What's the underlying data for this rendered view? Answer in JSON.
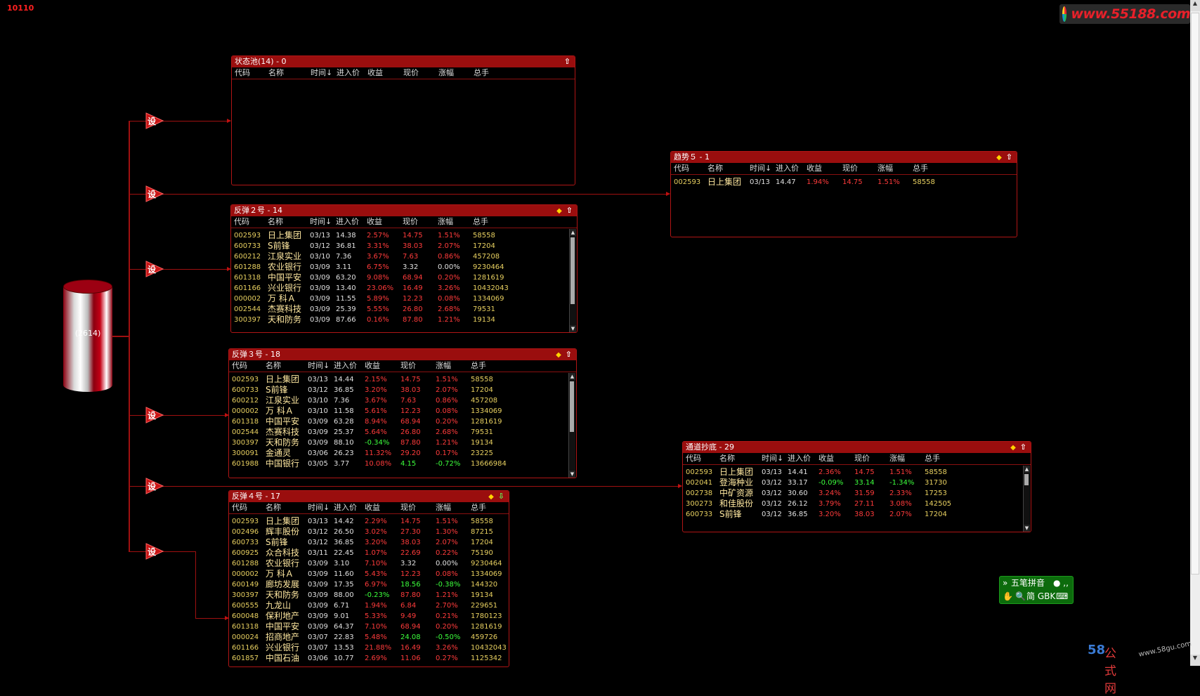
{
  "top_id": "10110",
  "logo_url": "www.55188.com",
  "database": {
    "label": "(2614)"
  },
  "set_label": "设",
  "columns": [
    "代码",
    "名称",
    "时间↓",
    "进入价",
    "收益",
    "现价",
    "涨幅",
    "总手"
  ],
  "colors": {
    "title_bar": "#9a0e0e",
    "border": "#b01515",
    "up": "#ff3b3b",
    "down": "#3cff3c",
    "code": "#e8d060"
  },
  "panels": {
    "p1": {
      "title": "状态池(14) - 0",
      "rows": []
    },
    "p2": {
      "title": "反弹２号 - 14",
      "rows": [
        [
          "002593",
          "日上集团",
          "03/13",
          "14.38",
          "2.57%",
          "14.75",
          "1.51%",
          "58558"
        ],
        [
          "600733",
          "S前锋",
          "03/12",
          "36.81",
          "3.31%",
          "38.03",
          "2.07%",
          "17204"
        ],
        [
          "600212",
          "江泉实业",
          "03/10",
          "7.36",
          "3.67%",
          "7.63",
          "0.86%",
          "457208"
        ],
        [
          "601288",
          "农业银行",
          "03/09",
          "3.11",
          "6.75%",
          "3.32",
          "0.00%",
          "9230464"
        ],
        [
          "601318",
          "中国平安",
          "03/09",
          "63.20",
          "9.08%",
          "68.94",
          "0.20%",
          "1281619"
        ],
        [
          "601166",
          "兴业银行",
          "03/09",
          "13.40",
          "23.06%",
          "16.49",
          "3.26%",
          "10432043"
        ],
        [
          "000002",
          "万 科Ａ",
          "03/09",
          "11.55",
          "5.89%",
          "12.23",
          "0.08%",
          "1334069"
        ],
        [
          "002544",
          "杰赛科技",
          "03/09",
          "25.39",
          "5.55%",
          "26.80",
          "2.68%",
          "79531"
        ],
        [
          "300397",
          "天和防务",
          "03/09",
          "87.66",
          "0.16%",
          "87.80",
          "1.21%",
          "19134"
        ]
      ]
    },
    "p3": {
      "title": "反弹３号 - 18",
      "rows": [
        [
          "002593",
          "日上集团",
          "03/13",
          "14.44",
          "2.15%",
          "14.75",
          "1.51%",
          "58558"
        ],
        [
          "600733",
          "S前锋",
          "03/12",
          "36.85",
          "3.20%",
          "38.03",
          "2.07%",
          "17204"
        ],
        [
          "600212",
          "江泉实业",
          "03/10",
          "7.36",
          "3.67%",
          "7.63",
          "0.86%",
          "457208"
        ],
        [
          "000002",
          "万 科Ａ",
          "03/10",
          "11.58",
          "5.61%",
          "12.23",
          "0.08%",
          "1334069"
        ],
        [
          "601318",
          "中国平安",
          "03/09",
          "63.28",
          "8.94%",
          "68.94",
          "0.20%",
          "1281619"
        ],
        [
          "002544",
          "杰赛科技",
          "03/09",
          "25.37",
          "5.64%",
          "26.80",
          "2.68%",
          "79531"
        ],
        [
          "300397",
          "天和防务",
          "03/09",
          "88.10",
          "-0.34%",
          "87.80",
          "1.21%",
          "19134"
        ],
        [
          "300091",
          "金通灵",
          "03/06",
          "26.23",
          "11.32%",
          "29.20",
          "0.17%",
          "23225"
        ],
        [
          "601988",
          "中国银行",
          "03/05",
          "3.77",
          "10.08%",
          "4.15",
          "-0.72%",
          "13666984"
        ]
      ]
    },
    "p4": {
      "title": "反弹４号 - 17",
      "rows": [
        [
          "002593",
          "日上集团",
          "03/13",
          "14.42",
          "2.29%",
          "14.75",
          "1.51%",
          "58558"
        ],
        [
          "002496",
          "辉丰股份",
          "03/12",
          "26.50",
          "3.02%",
          "27.30",
          "1.30%",
          "87215"
        ],
        [
          "600733",
          "S前锋",
          "03/12",
          "36.85",
          "3.20%",
          "38.03",
          "2.07%",
          "17204"
        ],
        [
          "600925",
          "众合科技",
          "03/11",
          "22.45",
          "1.07%",
          "22.69",
          "0.22%",
          "75190"
        ],
        [
          "601288",
          "农业银行",
          "03/09",
          "3.10",
          "7.10%",
          "3.32",
          "0.00%",
          "9230464"
        ],
        [
          "000002",
          "万 科Ａ",
          "03/09",
          "11.60",
          "5.43%",
          "12.23",
          "0.08%",
          "1334069"
        ],
        [
          "600149",
          "廊坊发展",
          "03/09",
          "17.35",
          "6.97%",
          "18.56",
          "-0.38%",
          "144320"
        ],
        [
          "300397",
          "天和防务",
          "03/09",
          "88.00",
          "-0.23%",
          "87.80",
          "1.21%",
          "19134"
        ],
        [
          "600555",
          "九龙山",
          "03/09",
          "6.71",
          "1.94%",
          "6.84",
          "2.70%",
          "229651"
        ],
        [
          "600048",
          "保利地产",
          "03/09",
          "9.01",
          "5.33%",
          "9.49",
          "0.21%",
          "1780123"
        ],
        [
          "601318",
          "中国平安",
          "03/09",
          "64.37",
          "7.10%",
          "68.94",
          "0.20%",
          "1281619"
        ],
        [
          "000024",
          "招商地产",
          "03/07",
          "22.83",
          "5.48%",
          "24.08",
          "-0.50%",
          "459726"
        ],
        [
          "601166",
          "兴业银行",
          "03/07",
          "13.53",
          "21.88%",
          "16.49",
          "3.26%",
          "10432043"
        ],
        [
          "601857",
          "中国石油",
          "03/06",
          "10.77",
          "2.69%",
          "11.06",
          "0.27%",
          "1125342"
        ]
      ]
    },
    "p5": {
      "title": "趋势５ - 1",
      "rows": [
        [
          "002593",
          "日上集团",
          "03/13",
          "14.47",
          "1.94%",
          "14.75",
          "1.51%",
          "58558"
        ]
      ]
    },
    "p6": {
      "title": "通道抄底 - 29",
      "rows": [
        [
          "002593",
          "日上集团",
          "03/13",
          "14.41",
          "2.36%",
          "14.75",
          "1.51%",
          "58558"
        ],
        [
          "002041",
          "登海种业",
          "03/12",
          "33.17",
          "-0.09%",
          "33.14",
          "-1.34%",
          "31730"
        ],
        [
          "002738",
          "中矿资源",
          "03/12",
          "30.60",
          "3.24%",
          "31.59",
          "2.33%",
          "17253"
        ],
        [
          "300273",
          "和佳股份",
          "03/12",
          "26.12",
          "3.79%",
          "27.11",
          "3.08%",
          "142505"
        ],
        [
          "600733",
          "S前锋",
          "03/12",
          "36.85",
          "3.20%",
          "38.03",
          "2.07%",
          "17204"
        ]
      ]
    }
  },
  "ime": {
    "mode": "五笔拼音",
    "charset": "简 GBK"
  },
  "footer": {
    "brand_num": "58",
    "brand_text": "公式网",
    "url": "www.58gu.com"
  }
}
